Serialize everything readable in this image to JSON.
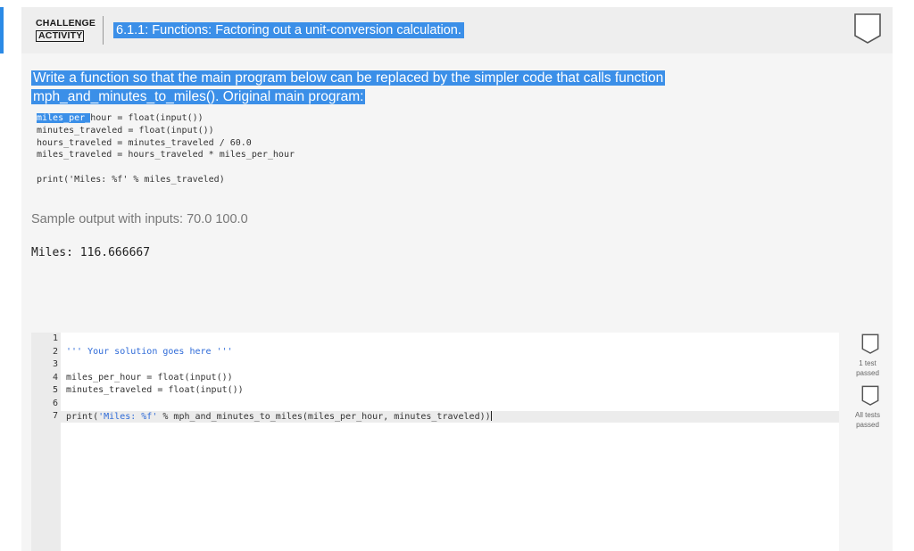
{
  "header": {
    "badge_line1": "CHALLENGE",
    "badge_line2": "ACTIVITY",
    "title": "6.1.1: Functions: Factoring out a unit-conversion calculation."
  },
  "prompt": {
    "line1": "Write a function so that the main program below can be replaced by the simpler code that calls function",
    "line2": "mph_and_minutes_to_miles(). Original main program:"
  },
  "original_code": {
    "line1_selected": "miles_per_",
    "line1_rest": "hour = float(input())",
    "line2": "minutes_traveled = float(input())",
    "line3": "hours_traveled = minutes_traveled / 60.0",
    "line4": "miles_traveled = hours_traveled * miles_per_hour",
    "line5": "print('Miles: %f' % miles_traveled)"
  },
  "sample": {
    "label": "Sample output with inputs: 70.0 100.0",
    "output": "Miles: 116.666667"
  },
  "editor": {
    "line_numbers": [
      "1",
      "2",
      "3",
      "4",
      "5",
      "6",
      "7"
    ],
    "line2": "''' Your solution goes here '''",
    "line4": "miles_per_hour = float(input())",
    "line5": "minutes_traveled = float(input())",
    "line7_a": "print(",
    "line7_str": "'Miles: %f'",
    "line7_b": " % mph_and_minutes_to_miles(miles_per_hour, minutes_traveled))"
  },
  "tests": {
    "test1_line1": "1 test",
    "test1_line2": "passed",
    "all_line1": "All tests",
    "all_line2": "passed"
  },
  "colors": {
    "accent": "#2b8ae6",
    "selection": "#3b8fe8"
  }
}
